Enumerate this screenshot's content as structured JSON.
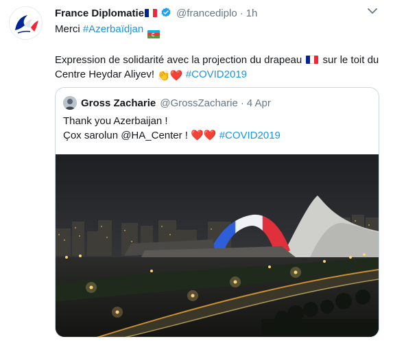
{
  "tweet": {
    "author_name": "France Diplomatie",
    "handle": "@francediplo",
    "separator": "·",
    "time": "1h",
    "line1_prefix": "Merci ",
    "line1_hashtag": "#Azerbaïdjan",
    "body_part1": "Expression de solidarité avec la projection du drapeau ",
    "body_part2": " sur le toit du Centre Heydar Aliyev! ",
    "body_hashtag": "#COVID2019",
    "clap_emoji": "👏",
    "heart_emoji": "❤️"
  },
  "quote": {
    "author_name": "Gross Zacharie",
    "handle": "@GrossZacharie",
    "separator": "·",
    "date": "4 Apr",
    "line1": "Thank you Azerbaijan !",
    "line2_prefix": "Çox sarolun @HA_Center ! ",
    "line2_hashtag": "#COVID2019",
    "hearts": "❤️❤️"
  },
  "colors": {
    "accent": "#1b95e0",
    "text_primary": "#14171a",
    "text_secondary": "#657786",
    "border": "#ccd6dd",
    "verified": "#1da1f2",
    "heart": "#e0245e",
    "flag_fr_blue": "#002395",
    "flag_fr_white": "#ffffff",
    "flag_fr_red": "#ed2939",
    "flag_az_blue": "#00b5e2",
    "flag_az_red": "#ef3340",
    "flag_az_green": "#509e2f"
  },
  "icons": {
    "verified": "verified-badge-icon",
    "more": "chevron-down-icon",
    "flag_fr": "france-flag-icon",
    "flag_az": "azerbaijan-flag-icon"
  }
}
